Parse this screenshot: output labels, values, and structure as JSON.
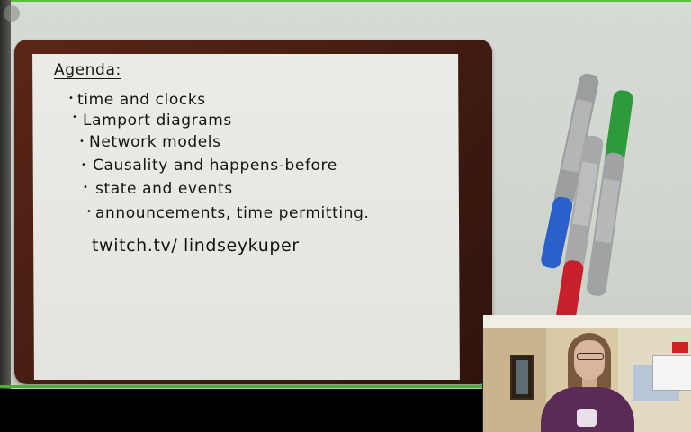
{
  "whiteboard": {
    "title": "Agenda:",
    "items": [
      "time and clocks",
      "Lamport diagrams",
      "Network models",
      "Causality and happens-before",
      "state and events",
      "announcements, time permitting."
    ],
    "link": "twitch.tv/ lindseykuper"
  },
  "markers": [
    {
      "name": "blue-sharpie",
      "cap_color": "#2b5fc9"
    },
    {
      "name": "red-sharpie",
      "cap_color": "#c8202a"
    },
    {
      "name": "green-sharpie",
      "cap_color": "#2d9b3a"
    }
  ],
  "colors": {
    "frame_border": "#4caf30",
    "clipboard": "#4a1e12",
    "paper": "#e8e7e2"
  }
}
